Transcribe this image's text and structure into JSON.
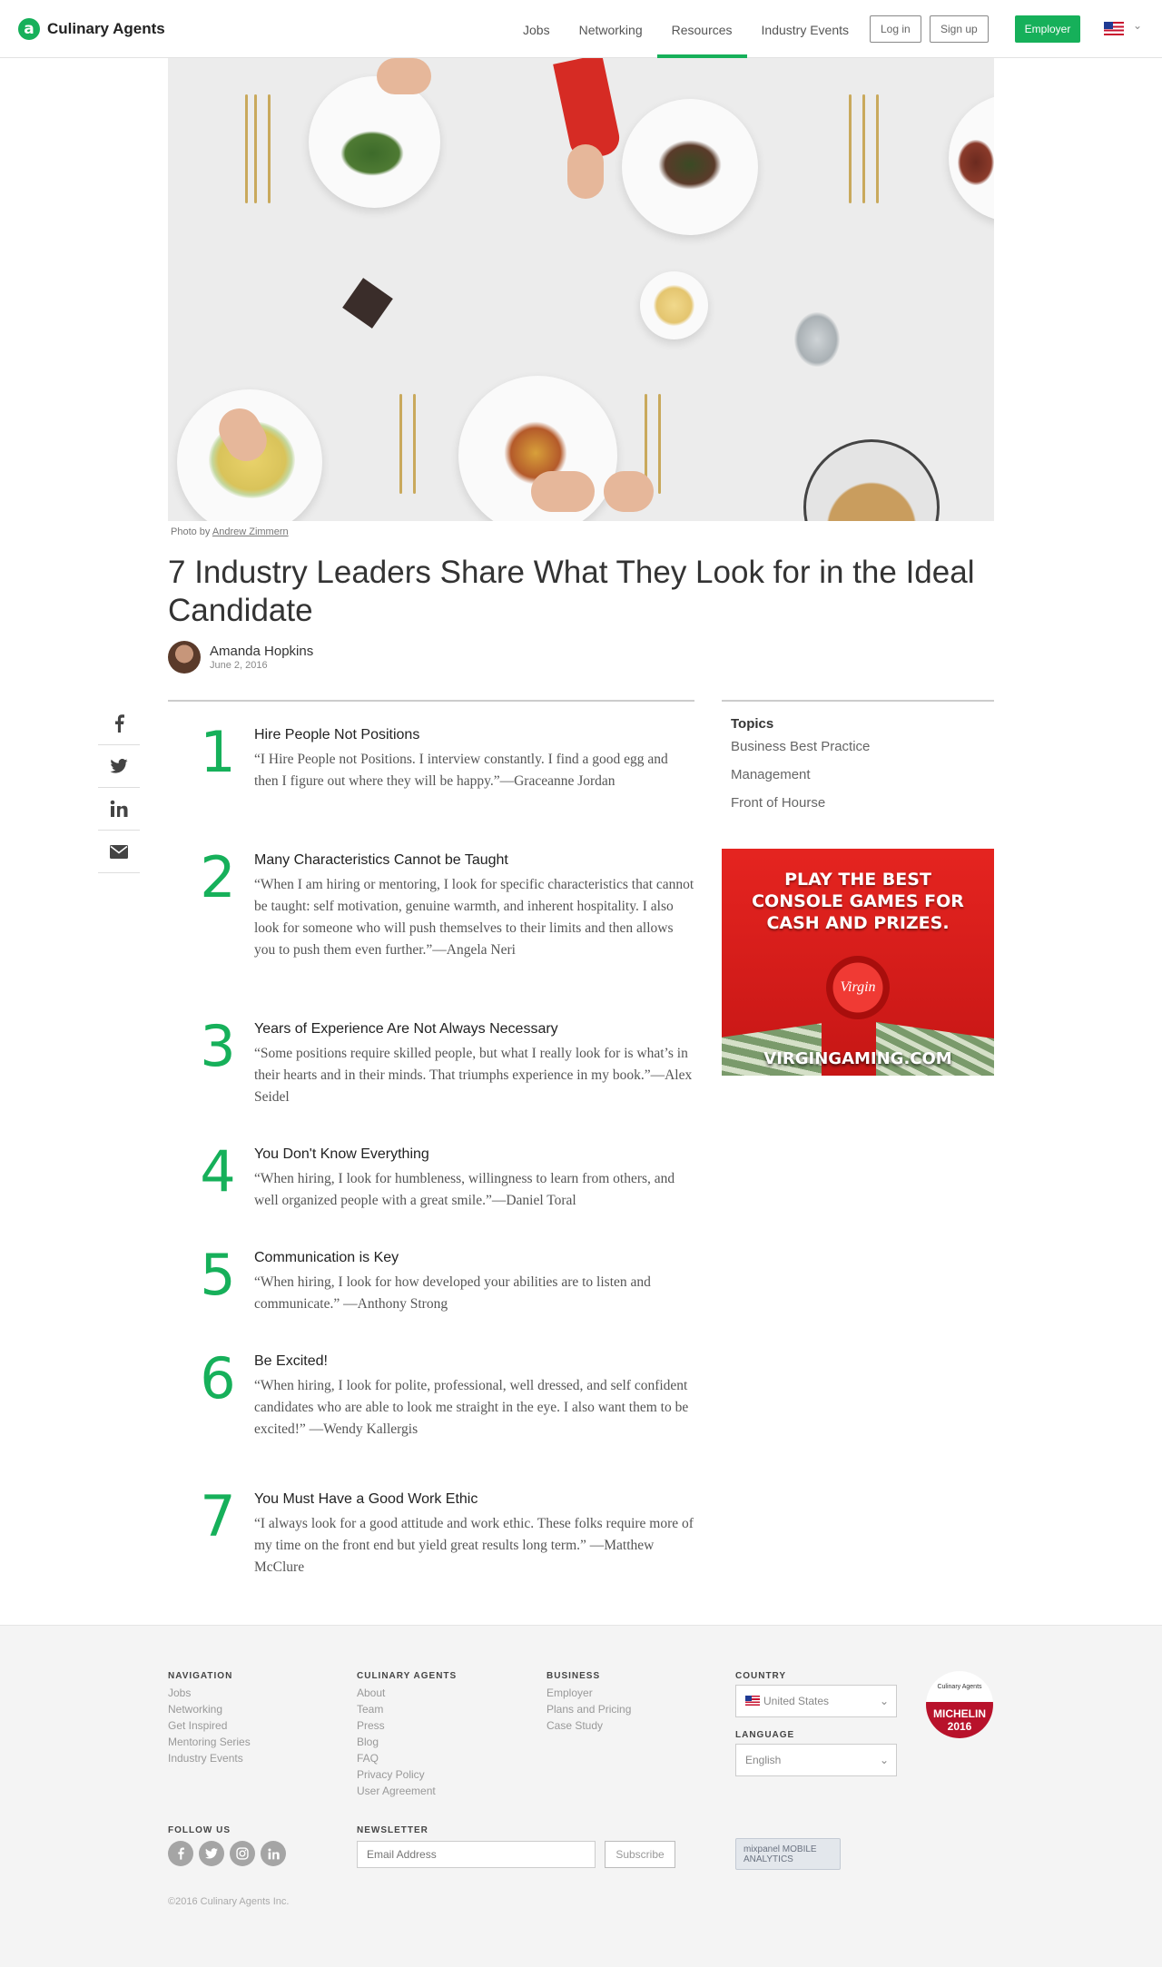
{
  "header": {
    "logo_text": "Culinary Agents",
    "logo_mark": "a",
    "nav": [
      "Jobs",
      "Networking",
      "Resources",
      "Industry Events"
    ],
    "active_nav": "Resources",
    "login_label": "Log in",
    "signup_label": "Sign up",
    "employer_label": "Employer",
    "locale_icon": "us-flag-icon",
    "accent_color": "#16b05a"
  },
  "hero": {
    "caption_prefix": "Photo by",
    "caption_author": "Andrew Zimmern"
  },
  "article": {
    "title": "7 Industry Leaders Share What They Look for in the Ideal Candidate",
    "author": "Amanda Hopkins",
    "date": "June 2, 2016",
    "items": [
      {
        "num": "1",
        "heading": "Hire People Not Positions",
        "quote": "“I Hire People not Positions. I interview constantly. I find a good egg and then I figure out where they will be happy.”—Graceanne Jordan"
      },
      {
        "num": "2",
        "heading": "Many Characteristics Cannot be Taught",
        "quote": "“When I am hiring or mentoring, I look for specific characteristics that cannot be taught: self motivation, genuine warmth, and inherent hospitality. I also look for someone who will push themselves to their limits and then allows you to push them even further.”—Angela Neri"
      },
      {
        "num": "3",
        "heading": "Years of Experience Are Not Always Necessary",
        "quote": "“Some positions require skilled people, but what I really look for is what’s in their hearts and in their minds. That triumphs experience in my book.”—Alex Seidel"
      },
      {
        "num": "4",
        "heading": "You Don't Know Everything",
        "quote": "“When hiring, I look for humbleness, willingness to learn from others, and well organized people with a great smile.”—Daniel Toral"
      },
      {
        "num": "5",
        "heading": "Communication is Key",
        "quote": "“When hiring, I look for how developed your abilities are to listen and communicate.” —Anthony Strong"
      },
      {
        "num": "6",
        "heading": "Be Excited!",
        "quote": "“When hiring, I look for polite, professional, well dressed, and self confident candidates who are able to look me straight in the eye. I also want them to be excited!” —Wendy Kallergis"
      },
      {
        "num": "7",
        "heading": "You Must Have a Good Work Ethic",
        "quote": "“I always look for a good attitude and work ethic. These folks require more of my time on the front end but yield great results long term.” —Matthew McClure"
      }
    ]
  },
  "share": {
    "icons": [
      "facebook-icon",
      "twitter-icon",
      "linkedin-icon",
      "email-icon"
    ]
  },
  "sidebar": {
    "topics_heading": "Topics",
    "topics": [
      "Business Best Practice",
      "Management",
      "Front of Hourse"
    ]
  },
  "ad": {
    "headline": "PLAY THE BEST\nCONSOLE GAMES FOR\nCASH AND PRIZES.",
    "brand": "Virgin",
    "url": "VIRGINGAMING.COM"
  },
  "footer": {
    "navigation": {
      "heading": "NAVIGATION",
      "links": [
        "Jobs",
        "Networking",
        "Get Inspired",
        "Mentoring Series",
        "Industry Events"
      ]
    },
    "culinary": {
      "heading": "CULINARY AGENTS",
      "links": [
        "About",
        "Team",
        "Press",
        "Blog",
        "FAQ",
        "Privacy Policy",
        "User Agreement"
      ]
    },
    "business": {
      "heading": "BUSINESS",
      "links": [
        "Employer",
        "Plans and Pricing",
        "Case Study"
      ]
    },
    "country_heading": "COUNTRY",
    "country_value": "United States",
    "language_heading": "LANGUAGE",
    "language_value": "English",
    "badge_top": "Culinary Agents",
    "badge_bottom": "MICHELIN 2016",
    "follow_heading": "FOLLOW US",
    "social_icons": [
      "facebook-icon",
      "twitter-icon",
      "instagram-icon",
      "linkedin-icon"
    ],
    "newsletter_heading": "NEWSLETTER",
    "newsletter_placeholder": "Email Address",
    "subscribe_label": "Subscribe",
    "mixpanel_label": "mixpanel MOBILE ANALYTICS",
    "copyright": "©2016 Culinary Agents Inc."
  }
}
